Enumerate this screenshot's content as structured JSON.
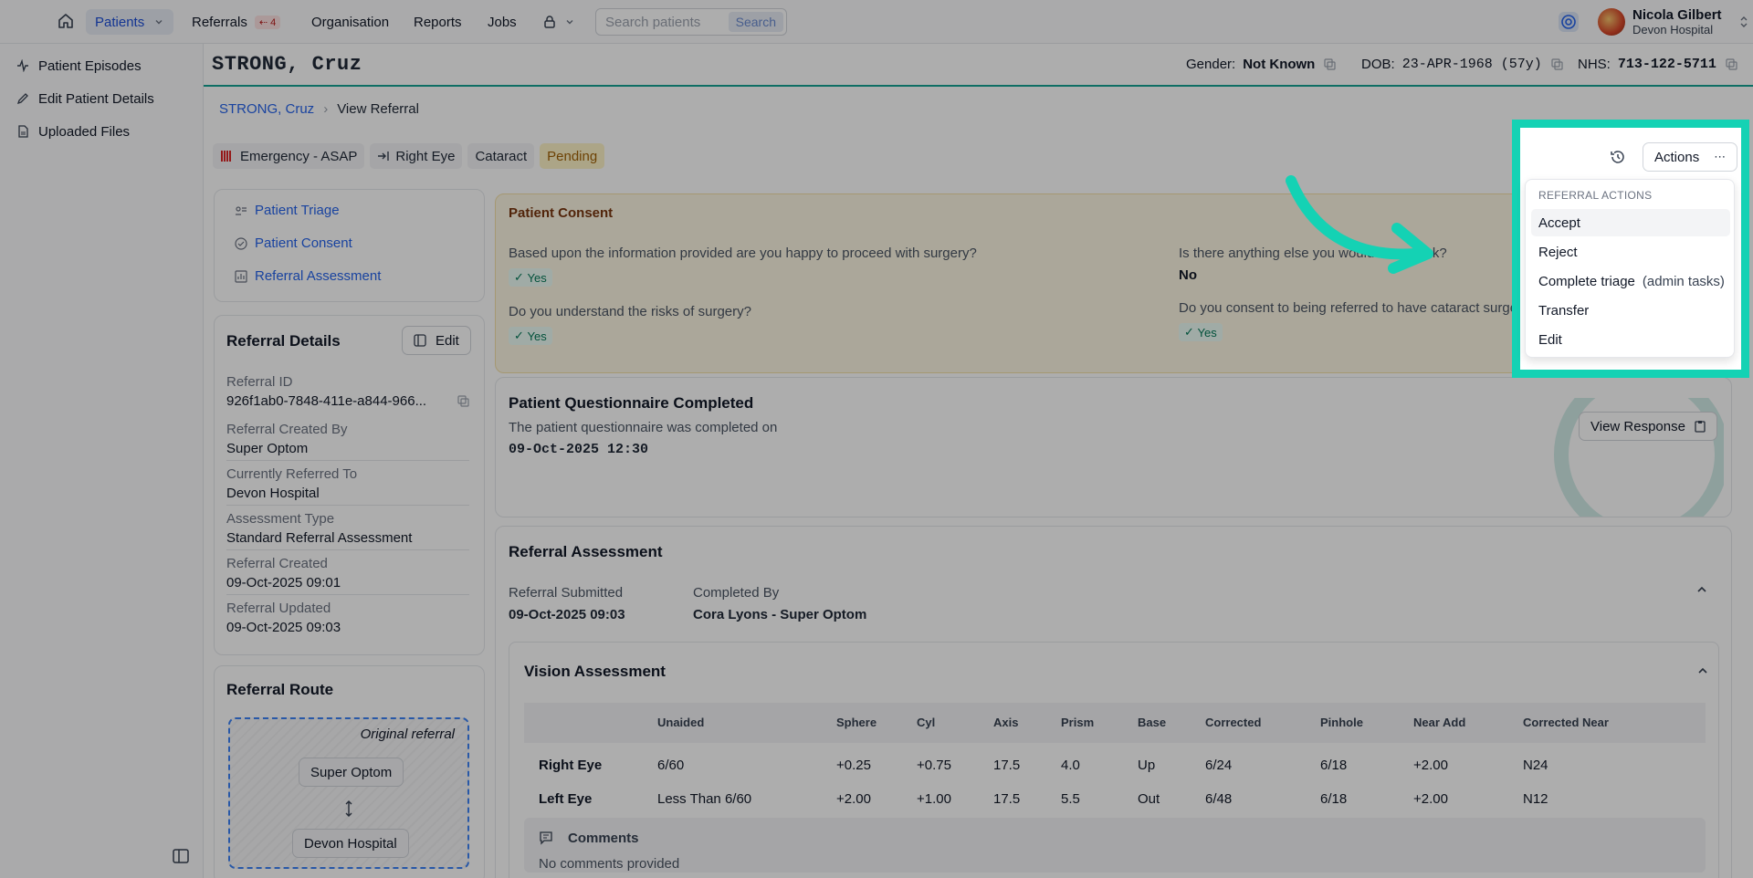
{
  "nav": {
    "patients": "Patients",
    "referrals": "Referrals",
    "referrals_badge": "⇠ 4",
    "organisation": "Organisation",
    "reports": "Reports",
    "jobs": "Jobs",
    "search_placeholder": "Search patients",
    "search_button": "Search"
  },
  "user": {
    "name": "Nicola Gilbert",
    "org": "Devon Hospital"
  },
  "sidebar": {
    "items": [
      {
        "label": "Patient Episodes",
        "icon": "activity-icon"
      },
      {
        "label": "Edit Patient Details",
        "icon": "pencil-icon"
      },
      {
        "label": "Uploaded Files",
        "icon": "file-icon"
      }
    ]
  },
  "patient": {
    "name": "STRONG, Cruz",
    "gender_label": "Gender:",
    "gender": "Not Known",
    "dob_label": "DOB:",
    "dob": "23-APR-1968 (57y)",
    "nhs_label": "NHS:",
    "nhs": "713-122-5711"
  },
  "breadcrumb": {
    "patient": "STRONG, Cruz",
    "current": "View Referral"
  },
  "tags": {
    "priority": "Emergency - ASAP",
    "eye": "Right Eye",
    "condition": "Cataract",
    "status": "Pending"
  },
  "section_nav": [
    "Patient Triage",
    "Patient Consent",
    "Referral Assessment"
  ],
  "referral_details": {
    "title": "Referral Details",
    "edit": "Edit",
    "fields": [
      {
        "label": "Referral ID",
        "value": "926f1ab0-7848-411e-a844-966..."
      },
      {
        "label": "Referral Created By",
        "value": "Super Optom"
      },
      {
        "label": "Currently Referred To",
        "value": "Devon Hospital"
      },
      {
        "label": "Assessment Type",
        "value": "Standard Referral Assessment"
      },
      {
        "label": "Referral Created",
        "value": "09-Oct-2025 09:01"
      },
      {
        "label": "Referral Updated",
        "value": "09-Oct-2025 09:03"
      }
    ]
  },
  "referral_route": {
    "title": "Referral Route",
    "original": "Original referral",
    "from": "Super Optom",
    "to": "Devon Hospital"
  },
  "consent": {
    "title": "Patient Consent",
    "q1": "Based upon the information provided are you happy to proceed with surgery?",
    "a1": "Yes",
    "q2": "Do you understand the risks of surgery?",
    "a2": "Yes",
    "q3": "Is there anything else you would",
    "q3b": "sk?",
    "a3": "No",
    "q4": "Do you consent to being referred to have cataract surger",
    "a4": "Yes"
  },
  "questionnaire": {
    "title": "Patient Questionnaire Completed",
    "subtitle": "The patient questionnaire was completed on",
    "date": "09-Oct-2025 12:30",
    "view": "View Response"
  },
  "assessment": {
    "title": "Referral Assessment",
    "submitted_label": "Referral Submitted",
    "submitted": "09-Oct-2025 09:03",
    "completed_label": "Completed By",
    "completed": "Cora Lyons - Super Optom"
  },
  "vision": {
    "title": "Vision Assessment",
    "headers": [
      "",
      "Unaided",
      "Sphere",
      "Cyl",
      "Axis",
      "Prism",
      "Base",
      "Corrected",
      "Pinhole",
      "Near Add",
      "Corrected Near"
    ],
    "rows": [
      [
        "Right Eye",
        "6/60",
        "+0.25",
        "+0.75",
        "17.5",
        "4.0",
        "Up",
        "6/24",
        "6/18",
        "+2.00",
        "N24"
      ],
      [
        "Left Eye",
        "Less Than 6/60",
        "+2.00",
        "+1.00",
        "17.5",
        "5.5",
        "Out",
        "6/48",
        "6/18",
        "+2.00",
        "N12"
      ]
    ],
    "comments_title": "Comments",
    "comments": "No comments provided"
  },
  "actions": {
    "button": "Actions",
    "header": "REFERRAL ACTIONS",
    "accept": "Accept",
    "reject": "Reject",
    "triage": "Complete triage",
    "triage_note": "(admin tasks)",
    "transfer": "Transfer",
    "edit": "Edit"
  },
  "colors": {
    "accent": "#14d2b4",
    "link": "#2563eb",
    "pending": "#a16207"
  }
}
